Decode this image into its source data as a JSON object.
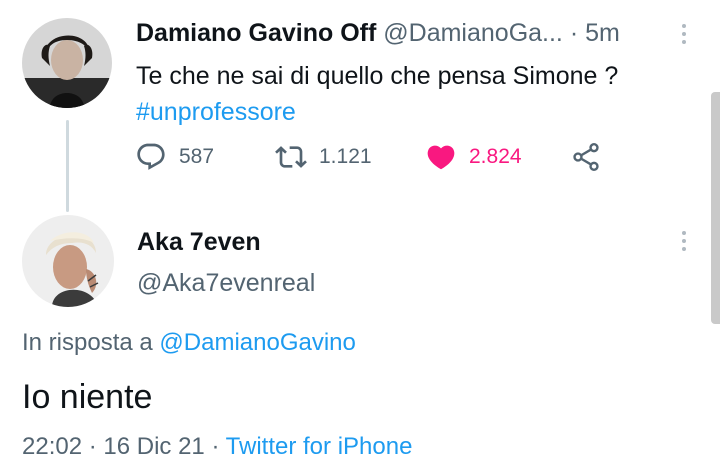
{
  "tweet": {
    "author_name": "Damiano Gavino Off",
    "author_handle": "@DamianoGa...",
    "separator": "·",
    "time": "5m",
    "text": "Te che ne sai di quello che pensa Simone ?",
    "hashtag": "#unprofessore",
    "replies": "587",
    "retweets": "1.121",
    "likes": "2.824",
    "liked": true
  },
  "reply": {
    "author_name": "Aka 7even",
    "author_handle": "@Aka7evenreal",
    "replying_to_prefix": "In risposta a",
    "replying_to_handle": "@DamianoGavino",
    "text": "Io niente",
    "date": "22:02 · 16 Dic 21 · ",
    "source": "Twitter for iPhone"
  },
  "icons": {
    "reply": "reply-icon",
    "retweet": "retweet-icon",
    "like": "heart-icon",
    "share": "share-icon",
    "more": "more-options-icon"
  },
  "colors": {
    "link": "#1d9bf0",
    "like": "#f91880",
    "secondary_text": "#536471",
    "primary_text": "#0f1419"
  }
}
